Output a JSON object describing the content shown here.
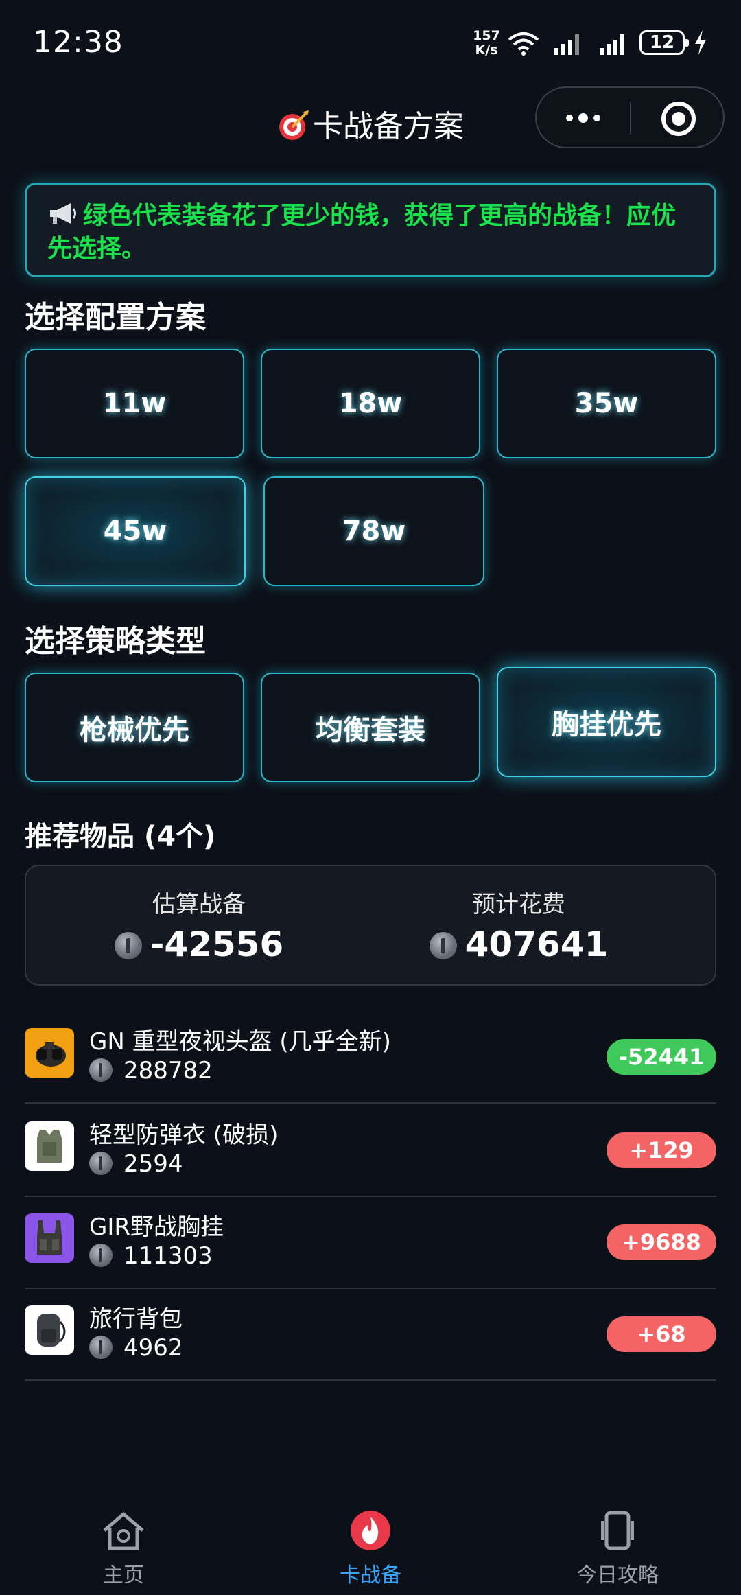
{
  "status_bar": {
    "time": "12:38",
    "net_speed_value": "157",
    "net_speed_unit": "K/s",
    "battery": "12"
  },
  "nav": {
    "title": "卡战备方案",
    "title_icon": "target-dart-icon"
  },
  "notice": {
    "icon": "megaphone-icon",
    "text": "绿色代表装备花了更少的钱，获得了更高的战备！应优先选择。"
  },
  "config": {
    "title": "选择配置方案",
    "options": [
      "11w",
      "18w",
      "35w",
      "45w",
      "78w"
    ],
    "selected": "45w"
  },
  "strategy": {
    "title": "选择策略类型",
    "options": [
      "枪械优先",
      "均衡套装",
      "胸挂优先"
    ],
    "selected": "胸挂优先"
  },
  "items_header": "推荐物品 (4个)",
  "summary": {
    "readiness_label": "估算战备",
    "readiness_value": "-42556",
    "cost_label": "预计花费",
    "cost_value": "407641"
  },
  "items": [
    {
      "name": "GN 重型夜视头盔 (几乎全新)",
      "price": "288782",
      "delta": "-52441",
      "delta_type": "negative",
      "thumb_color": "#f0a010"
    },
    {
      "name": "轻型防弹衣 (破损)",
      "price": "2594",
      "delta": "+129",
      "delta_type": "positive",
      "thumb_color": "#ffffff"
    },
    {
      "name": "GIR野战胸挂",
      "price": "111303",
      "delta": "+9688",
      "delta_type": "positive",
      "thumb_color": "#8a55e8"
    },
    {
      "name": "旅行背包",
      "price": "4962",
      "delta": "+68",
      "delta_type": "positive",
      "thumb_color": "#ffffff"
    }
  ],
  "tabbar": {
    "tabs": [
      {
        "label": "主页",
        "icon": "home-icon"
      },
      {
        "label": "卡战备",
        "icon": "flame-icon"
      },
      {
        "label": "今日攻略",
        "icon": "phone-guide-icon"
      }
    ],
    "active": "卡战备"
  },
  "colors": {
    "accent_cyan": "#2ab7c9",
    "notice_green": "#19e34a",
    "badge_negative": "#3ec95a",
    "badge_positive": "#f46464",
    "tab_active": "#35a6ff"
  }
}
